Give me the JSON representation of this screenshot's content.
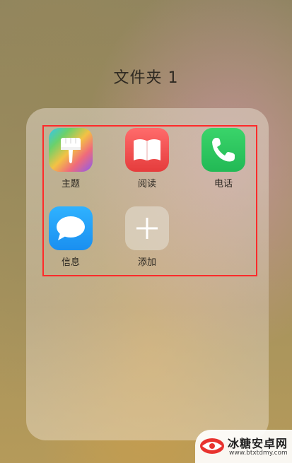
{
  "folder": {
    "title": "文件夹 1"
  },
  "apps": [
    {
      "label": "主题",
      "icon": "paintbrush-icon",
      "color": "#8a5cf0"
    },
    {
      "label": "阅读",
      "icon": "book-icon",
      "color": "#e53c3c"
    },
    {
      "label": "电话",
      "icon": "phone-icon",
      "color": "#22b955"
    },
    {
      "label": "信息",
      "icon": "message-bubble-icon",
      "color": "#1a8ff0"
    },
    {
      "label": "添加",
      "icon": "plus-icon",
      "color": "#ffffff"
    }
  ],
  "highlight": {
    "color": "#ff2a2a"
  },
  "watermark": {
    "name": "冰糖安卓网",
    "url": "www.btxtdmy.com"
  }
}
